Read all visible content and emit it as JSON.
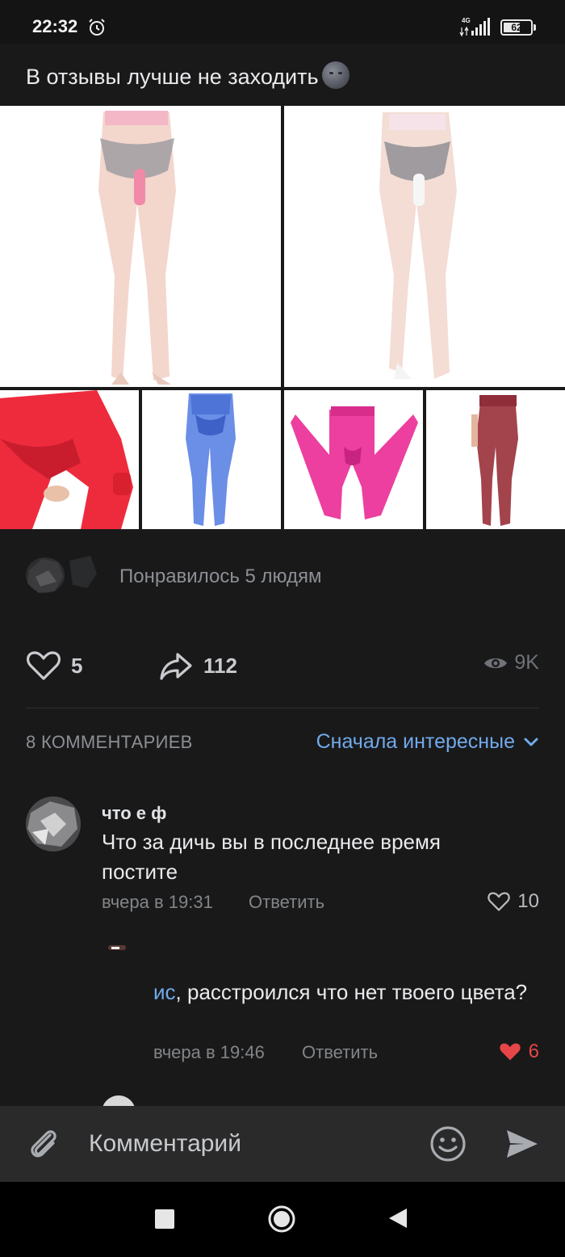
{
  "status_bar": {
    "time": "22:32",
    "network": "4G",
    "battery": 62,
    "battery_label": "62"
  },
  "post": {
    "text": "В отзывы лучше не заходить",
    "emoji": "new-moon-face-emoji"
  },
  "likes_summary": {
    "text": "Понравилось 5 людям"
  },
  "actions": {
    "likes": "5",
    "shares": "112",
    "views": "9K"
  },
  "comments_header": {
    "count_label": "8 КОММЕНТАРИЕВ",
    "sort_label": "Сначала интересные"
  },
  "comments": [
    {
      "author": "что е ф",
      "text": "Что за дичь вы в последнее время постите",
      "date": "вчера в 19:31",
      "reply_label": "Ответить",
      "likes": "10",
      "liked": false
    },
    {
      "mention": "ис",
      "text": ", расстроился что нет твоего цвета?",
      "date": "вчера в 19:46",
      "reply_label": "Ответить",
      "likes": "6",
      "liked": true
    }
  ],
  "composer": {
    "placeholder": "Комментарий"
  },
  "colors": {
    "background": "#19191a",
    "accent": "#71aaeb",
    "liked": "#e64646",
    "muted": "#828588"
  }
}
